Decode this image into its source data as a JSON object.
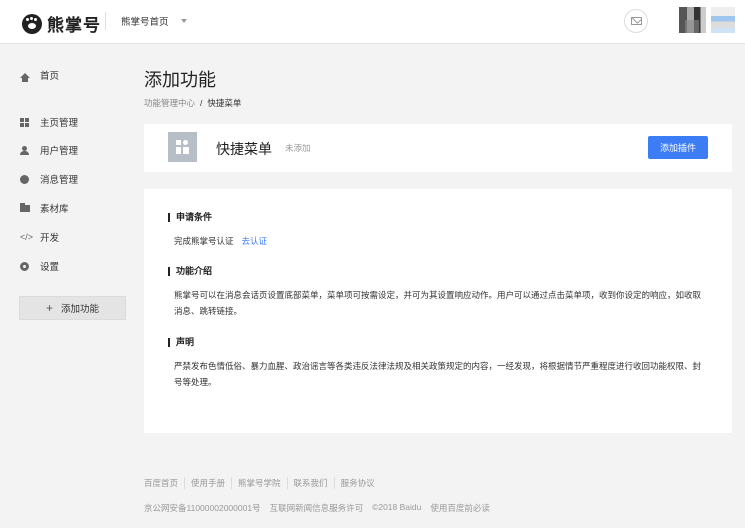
{
  "header": {
    "logo_text": "熊掌号",
    "account_switch": "熊掌号首页"
  },
  "sidebar": {
    "items": [
      {
        "label": "首页",
        "icon": "home-icon"
      },
      {
        "label": "主页管理",
        "icon": "grid-icon"
      },
      {
        "label": "用户管理",
        "icon": "user-icon"
      },
      {
        "label": "消息管理",
        "icon": "message-icon"
      },
      {
        "label": "素材库",
        "icon": "folder-icon"
      },
      {
        "label": "开发",
        "icon": "code-icon"
      },
      {
        "label": "设置",
        "icon": "gear-icon"
      }
    ],
    "add_button": "添加功能"
  },
  "main": {
    "title": "添加功能",
    "breadcrumb": {
      "parent": "功能管理中心",
      "separator": "/",
      "current": "快捷菜单"
    },
    "feature": {
      "name": "快捷菜单",
      "status": "未添加",
      "button": "添加插件"
    },
    "sections": [
      {
        "title": "申请条件",
        "body": "完成熊掌号认证",
        "link": "去认证"
      },
      {
        "title": "功能介绍",
        "body": "熊掌号可以在消息会话页设置底部菜单，菜单项可按需设定，并可为其设置响应动作。用户可以通过点击菜单项，收到你设定的响应，如收取消息、跳转链接。"
      },
      {
        "title": "声明",
        "body": "严禁发布色情低俗、暴力血腥、政治谣言等各类违反法律法规及相关政策规定的内容，一经发现，将根据情节严重程度进行收回功能权限、封号等处理。"
      }
    ]
  },
  "footer": {
    "links": [
      "百度首页",
      "使用手册",
      "熊掌号学院",
      "联系我们",
      "服务协议"
    ],
    "legal": [
      "京公网安备11000002000001号",
      "互联网新闻信息服务许可",
      "©2018 Baidu",
      "使用百度前必读"
    ]
  },
  "colors": {
    "accent": "#3c7cf5",
    "background": "#f3f3f3"
  }
}
